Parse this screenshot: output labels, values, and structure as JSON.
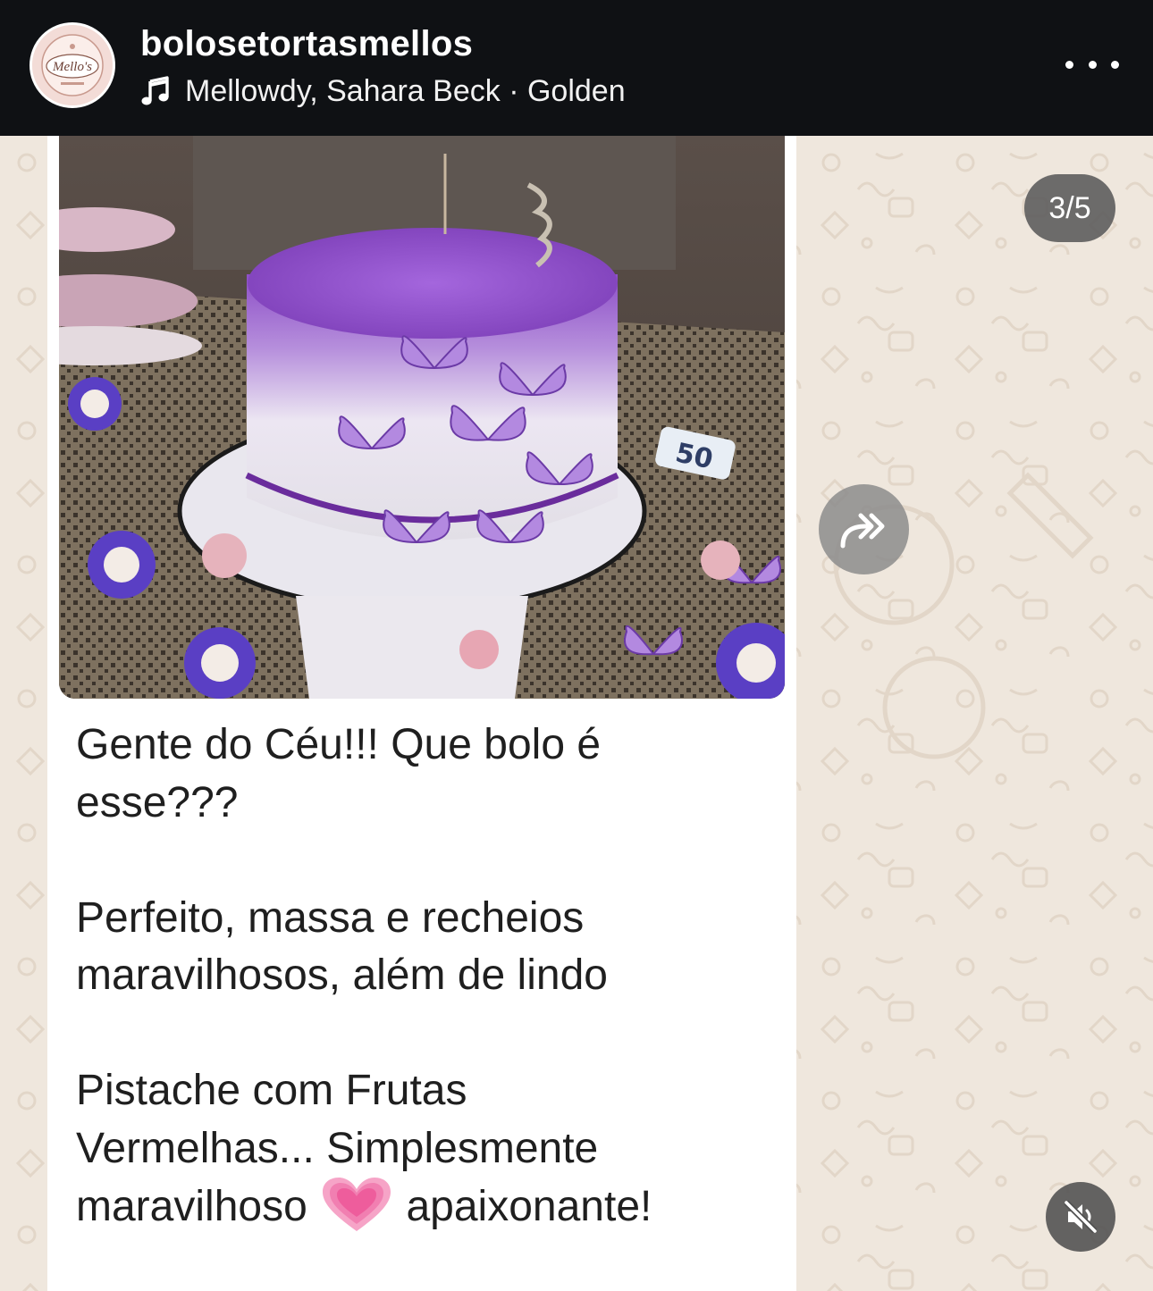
{
  "header": {
    "username": "bolosetortasmellos",
    "avatar_logo_text": "Mello's",
    "music_icon": "music-note-icon",
    "music": "Mellowdy, Sahara Beck · Golden",
    "more_icon": "more-horizontal-icon"
  },
  "story": {
    "counter": "3/5",
    "share_icon": "forward-arrow-icon",
    "mute_icon": "speaker-muted-icon",
    "photo": {
      "description_icon": "cake-photo",
      "cake_topper_text": "50"
    },
    "message": {
      "line1": "Gente do Céu!!! Que bolo é",
      "line2": "esse???",
      "line3": "Perfeito, massa e recheios",
      "line4": "maravilhosos, além de lindo",
      "line5": "Pistache com Frutas",
      "line6": "Vermelhas... Simplesmente",
      "line7_before": "maravilhoso",
      "line7_emoji": "growing-heart-emoji",
      "line7_after": "apaixonante!"
    }
  },
  "colors": {
    "header_bg": "#0f1114",
    "wallpaper": "#efe7dd",
    "bubble": "#ffffff",
    "cake_purple": "#8a4fc4"
  }
}
